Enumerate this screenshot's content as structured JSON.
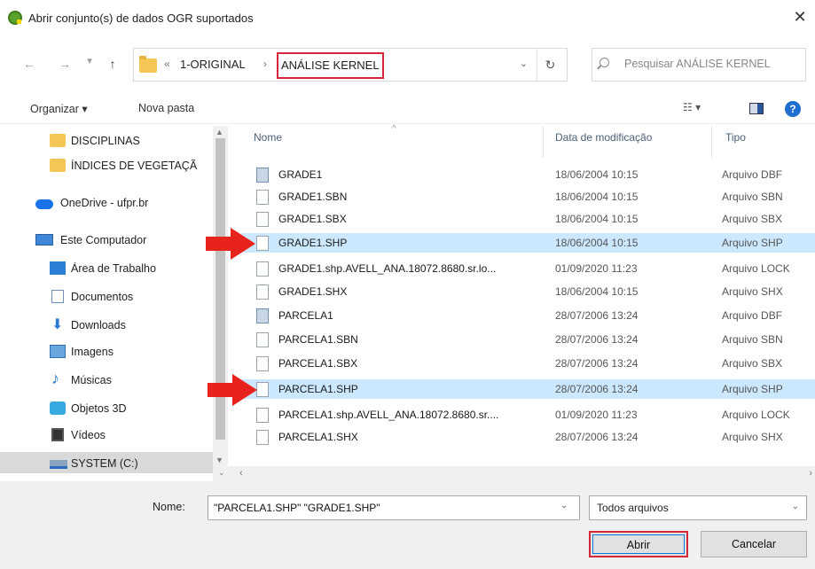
{
  "window": {
    "title": "Abrir conjunto(s) de dados OGR suportados",
    "close_glyph": "✕"
  },
  "nav": {
    "back": "←",
    "forward": "→",
    "recent": "▾",
    "up": "↑",
    "overflow": "«",
    "crumbs": [
      "1-ORIGINAL",
      "ANÁLISE KERNEL"
    ],
    "separator": "›",
    "dropdown": "⌄",
    "refresh": "↻",
    "search_placeholder": "Pesquisar ANÁLISE KERNEL"
  },
  "toolbar": {
    "organize": "Organizar ▾",
    "new_folder": "Nova pasta",
    "view": "☷ ▾",
    "help": "?"
  },
  "sidebar": {
    "items": [
      {
        "label": "DISCIPLINAS",
        "icon": "folder-icon"
      },
      {
        "label": "ÍNDICES DE VEGETAÇÃ",
        "icon": "folder-icon"
      },
      {
        "label": "OneDrive - ufpr.br",
        "icon": "cloud-icon"
      },
      {
        "label": "Este Computador",
        "icon": "computer-icon"
      },
      {
        "label": "Área de Trabalho",
        "icon": "desktop-icon"
      },
      {
        "label": "Documentos",
        "icon": "documents-icon"
      },
      {
        "label": "Downloads",
        "icon": "downloads-icon"
      },
      {
        "label": "Imagens",
        "icon": "pictures-icon"
      },
      {
        "label": "Músicas",
        "icon": "music-icon"
      },
      {
        "label": "Objetos 3D",
        "icon": "objects3d-icon"
      },
      {
        "label": "Vídeos",
        "icon": "videos-icon"
      },
      {
        "label": "SYSTEM (C:)",
        "icon": "drive-icon"
      }
    ]
  },
  "columns": {
    "name": "Nome",
    "date": "Data de modificação",
    "type": "Tipo",
    "sort": "^"
  },
  "files": [
    {
      "name": "GRADE1",
      "date": "18/06/2004 10:15",
      "type": "Arquivo DBF",
      "kind": "dbf",
      "selected": false
    },
    {
      "name": "GRADE1.SBN",
      "date": "18/06/2004 10:15",
      "type": "Arquivo SBN",
      "kind": "file",
      "selected": false
    },
    {
      "name": "GRADE1.SBX",
      "date": "18/06/2004 10:15",
      "type": "Arquivo SBX",
      "kind": "file",
      "selected": false
    },
    {
      "name": "GRADE1.SHP",
      "date": "18/06/2004 10:15",
      "type": "Arquivo SHP",
      "kind": "file",
      "selected": true
    },
    {
      "name": "GRADE1.shp.AVELL_ANA.18072.8680.sr.lo...",
      "date": "01/09/2020 11:23",
      "type": "Arquivo LOCK",
      "kind": "file",
      "selected": false
    },
    {
      "name": "GRADE1.SHX",
      "date": "18/06/2004 10:15",
      "type": "Arquivo SHX",
      "kind": "file",
      "selected": false
    },
    {
      "name": "PARCELA1",
      "date": "28/07/2006 13:24",
      "type": "Arquivo DBF",
      "kind": "dbf",
      "selected": false
    },
    {
      "name": "PARCELA1.SBN",
      "date": "28/07/2006 13:24",
      "type": "Arquivo SBN",
      "kind": "file",
      "selected": false
    },
    {
      "name": "PARCELA1.SBX",
      "date": "28/07/2006 13:24",
      "type": "Arquivo SBX",
      "kind": "file",
      "selected": false
    },
    {
      "name": "PARCELA1.SHP",
      "date": "28/07/2006 13:24",
      "type": "Arquivo SHP",
      "kind": "file",
      "selected": true
    },
    {
      "name": "PARCELA1.shp.AVELL_ANA.18072.8680.sr....",
      "date": "01/09/2020 11:23",
      "type": "Arquivo LOCK",
      "kind": "file",
      "selected": false
    },
    {
      "name": "PARCELA1.SHX",
      "date": "28/07/2006 13:24",
      "type": "Arquivo SHX",
      "kind": "file",
      "selected": false
    }
  ],
  "footer": {
    "name_label": "Nome:",
    "name_value": "\"PARCELA1.SHP\" \"GRADE1.SHP\"",
    "filter_value": "Todos arquivos",
    "open_label": "Abrir",
    "cancel_label": "Cancelar"
  },
  "colors": {
    "highlight_border": "#d6263a",
    "arrow": "#e8231d",
    "selection": "#cce8ff"
  }
}
